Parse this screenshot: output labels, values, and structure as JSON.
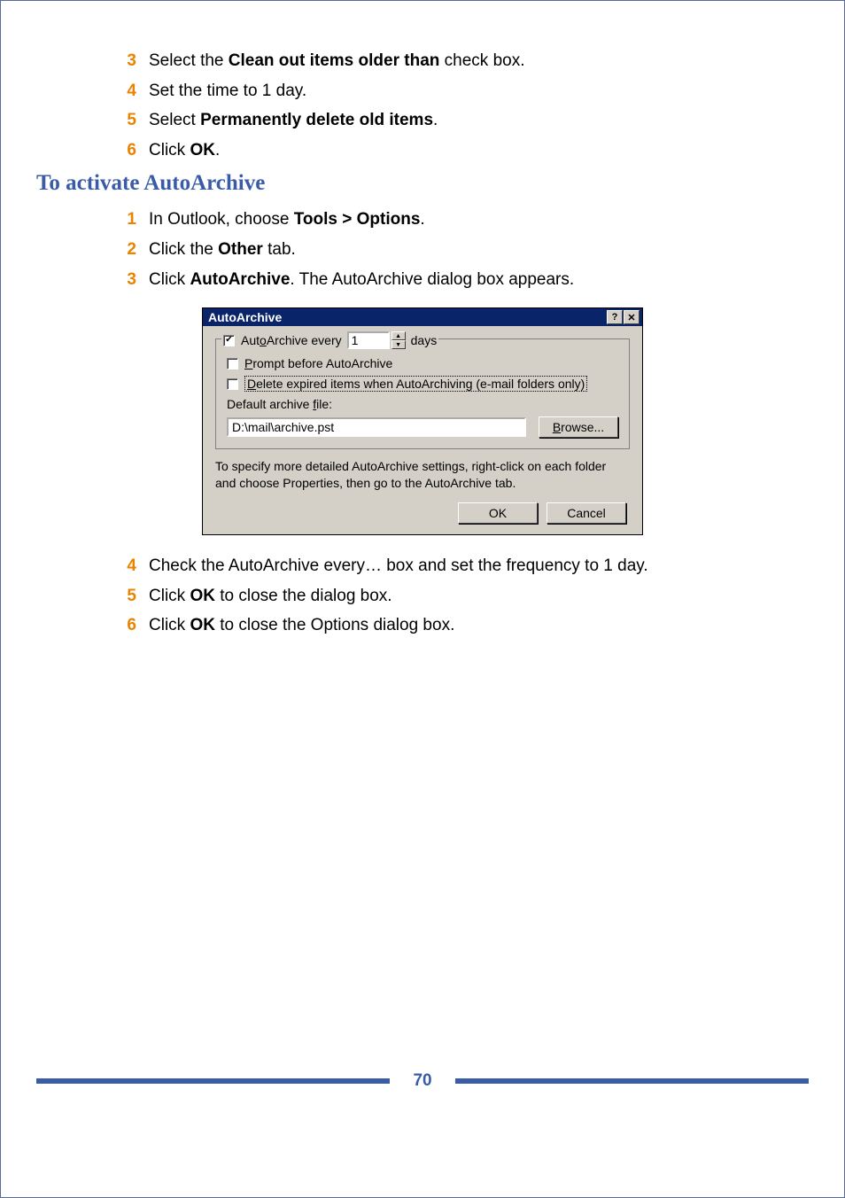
{
  "steps_a": [
    {
      "n": "3",
      "html": "Select the <b>Clean out items older than</b> check box."
    },
    {
      "n": "4",
      "html": "Set the time to 1 day."
    },
    {
      "n": "5",
      "html": "Select <b>Permanently delete old items</b>."
    },
    {
      "n": "6",
      "html": "Click <b>OK</b>."
    }
  ],
  "heading": "To activate AutoArchive",
  "steps_b": [
    {
      "n": "1",
      "html": "In Outlook, choose <b>Tools > Options</b>."
    },
    {
      "n": "2",
      "html": "Click the <b>Other</b> tab."
    },
    {
      "n": "3",
      "html": "Click <b>AutoArchive</b>. The AutoArchive dialog box appears."
    }
  ],
  "dialog": {
    "title": "AutoArchive",
    "help_glyph": "?",
    "close_glyph": "✕",
    "autoarchive_every_pre": "Aut",
    "autoarchive_every_u": "o",
    "autoarchive_every_post": "Archive every",
    "days_value": "1",
    "days_label": "days",
    "prompt_u": "P",
    "prompt_post": "rompt before AutoArchive",
    "delete_u": "D",
    "delete_post": "elete expired items when AutoArchiving (e-mail folders only)",
    "default_file_pre": "Default archive ",
    "default_file_u": "f",
    "default_file_post": "ile:",
    "file_value": "D:\\mail\\archive.pst",
    "browse_u": "B",
    "browse_post": "rowse...",
    "hint": "To specify more detailed AutoArchive settings, right-click on each folder and choose Properties, then go to the AutoArchive tab.",
    "ok": "OK",
    "cancel": "Cancel"
  },
  "steps_c": [
    {
      "n": "4",
      "html": "Check the AutoArchive every… box and set the frequency to 1 day."
    },
    {
      "n": "5",
      "html": "Click <b>OK</b> to close the dialog box."
    },
    {
      "n": "6",
      "html": "Click <b>OK</b> to close the Options dialog box."
    }
  ],
  "page_number": "70"
}
